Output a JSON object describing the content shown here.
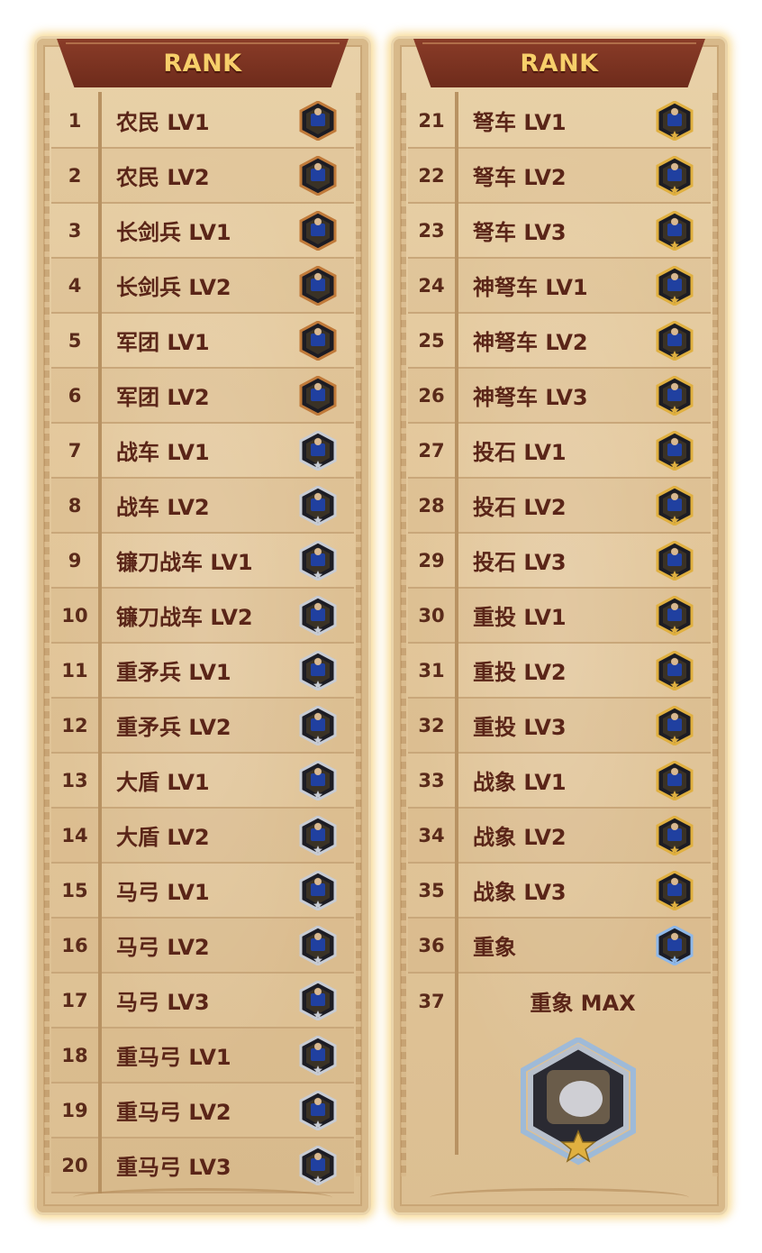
{
  "left": {
    "title": "RANK",
    "rows": [
      {
        "rank": "1",
        "name": "农民 LV1",
        "icon": "villager-badge-icon",
        "tier": "bronze"
      },
      {
        "rank": "2",
        "name": "农民 LV2",
        "icon": "villager-badge-icon",
        "tier": "bronze"
      },
      {
        "rank": "3",
        "name": "长剑兵 LV1",
        "icon": "longswordsman-badge-icon",
        "tier": "bronze"
      },
      {
        "rank": "4",
        "name": "长剑兵 LV2",
        "icon": "longswordsman-badge-icon",
        "tier": "bronze"
      },
      {
        "rank": "5",
        "name": "军团 LV1",
        "icon": "legion-badge-icon",
        "tier": "bronze"
      },
      {
        "rank": "6",
        "name": "军团 LV2",
        "icon": "legion-badge-icon",
        "tier": "bronze"
      },
      {
        "rank": "7",
        "name": "战车 LV1",
        "icon": "chariot-badge-icon",
        "tier": "silver"
      },
      {
        "rank": "8",
        "name": "战车 LV2",
        "icon": "chariot-badge-icon",
        "tier": "silver"
      },
      {
        "rank": "9",
        "name": "镰刀战车 LV1",
        "icon": "scythe-chariot-badge-icon",
        "tier": "silver"
      },
      {
        "rank": "10",
        "name": "镰刀战车 LV2",
        "icon": "scythe-chariot-badge-icon",
        "tier": "silver"
      },
      {
        "rank": "11",
        "name": "重矛兵 LV1",
        "icon": "heavy-spearman-badge-icon",
        "tier": "silver"
      },
      {
        "rank": "12",
        "name": "重矛兵 LV2",
        "icon": "heavy-spearman-badge-icon",
        "tier": "silver"
      },
      {
        "rank": "13",
        "name": "大盾 LV1",
        "icon": "big-shield-badge-icon",
        "tier": "silver"
      },
      {
        "rank": "14",
        "name": "大盾 LV2",
        "icon": "big-shield-badge-icon",
        "tier": "silver"
      },
      {
        "rank": "15",
        "name": "马弓 LV1",
        "icon": "horse-archer-badge-icon",
        "tier": "silver"
      },
      {
        "rank": "16",
        "name": "马弓 LV2",
        "icon": "horse-archer-badge-icon",
        "tier": "silver"
      },
      {
        "rank": "17",
        "name": "马弓 LV3",
        "icon": "horse-archer-badge-icon",
        "tier": "silver"
      },
      {
        "rank": "18",
        "name": "重马弓 LV1",
        "icon": "heavy-horse-archer-badge-icon",
        "tier": "silver"
      },
      {
        "rank": "19",
        "name": "重马弓 LV2",
        "icon": "heavy-horse-archer-badge-icon",
        "tier": "silver"
      },
      {
        "rank": "20",
        "name": "重马弓 LV3",
        "icon": "heavy-horse-archer-badge-icon",
        "tier": "silver"
      }
    ]
  },
  "right": {
    "title": "RANK",
    "rows": [
      {
        "rank": "21",
        "name": "弩车 LV1",
        "icon": "ballista-badge-icon",
        "tier": "gold"
      },
      {
        "rank": "22",
        "name": "弩车 LV2",
        "icon": "ballista-badge-icon",
        "tier": "gold"
      },
      {
        "rank": "23",
        "name": "弩车 LV3",
        "icon": "ballista-badge-icon",
        "tier": "gold"
      },
      {
        "rank": "24",
        "name": "神弩车 LV1",
        "icon": "divine-ballista-badge-icon",
        "tier": "gold"
      },
      {
        "rank": "25",
        "name": "神弩车 LV2",
        "icon": "divine-ballista-badge-icon",
        "tier": "gold"
      },
      {
        "rank": "26",
        "name": "神弩车 LV3",
        "icon": "divine-ballista-badge-icon",
        "tier": "gold"
      },
      {
        "rank": "27",
        "name": "投石 LV1",
        "icon": "catapult-badge-icon",
        "tier": "gold"
      },
      {
        "rank": "28",
        "name": "投石 LV2",
        "icon": "catapult-badge-icon",
        "tier": "gold"
      },
      {
        "rank": "29",
        "name": "投石 LV3",
        "icon": "catapult-badge-icon",
        "tier": "gold"
      },
      {
        "rank": "30",
        "name": "重投 LV1",
        "icon": "heavy-catapult-badge-icon",
        "tier": "gold"
      },
      {
        "rank": "31",
        "name": "重投 LV2",
        "icon": "heavy-catapult-badge-icon",
        "tier": "gold"
      },
      {
        "rank": "32",
        "name": "重投 LV3",
        "icon": "heavy-catapult-badge-icon",
        "tier": "gold"
      },
      {
        "rank": "33",
        "name": "战象 LV1",
        "icon": "war-elephant-badge-icon",
        "tier": "gold"
      },
      {
        "rank": "34",
        "name": "战象 LV2",
        "icon": "war-elephant-badge-icon",
        "tier": "gold"
      },
      {
        "rank": "35",
        "name": "战象 LV3",
        "icon": "war-elephant-badge-icon",
        "tier": "gold"
      },
      {
        "rank": "36",
        "name": "重象",
        "icon": "heavy-elephant-badge-icon",
        "tier": "platinum"
      }
    ],
    "final": {
      "rank": "37",
      "name": "重象 MAX",
      "icon": "heavy-elephant-max-badge-icon"
    }
  },
  "colors": {
    "banner": "#7a3322",
    "title_text": "#f7cf6a",
    "label_text": "#5a2518",
    "parchment": "#e3c79b",
    "glow": "#f6d078",
    "bronze": "#c07a3a",
    "silver": "#c8ccd4",
    "gold": "#e0b040",
    "platinum": "#8fb8e8",
    "unit_blue": "#2040a0"
  }
}
